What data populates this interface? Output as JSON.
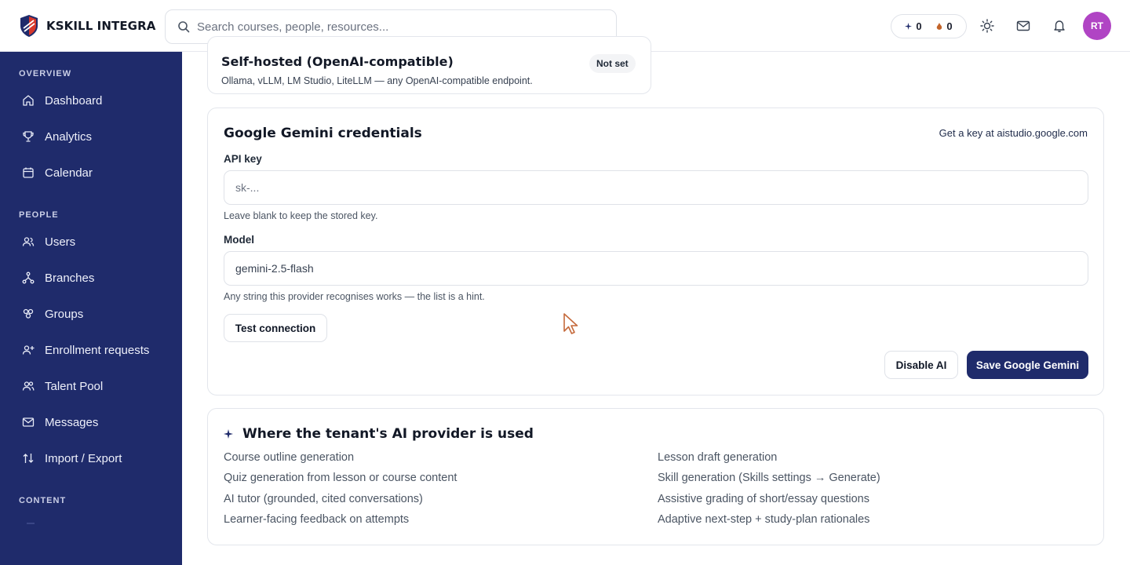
{
  "brand": {
    "name": "KSKILL INTEGRA"
  },
  "search": {
    "placeholder": "Search courses, people, resources..."
  },
  "header": {
    "sparkle_count": "0",
    "flame_count": "0",
    "avatar_initials": "RT",
    "icons": [
      "sun-icon",
      "mail-icon",
      "bell-icon"
    ]
  },
  "sidebar": {
    "sections": [
      {
        "label": "OVERVIEW"
      },
      {
        "label": "PEOPLE"
      },
      {
        "label": "CONTENT"
      }
    ],
    "items": [
      {
        "label": "Dashboard",
        "icon": "home-icon"
      },
      {
        "label": "Analytics",
        "icon": "trophy-icon"
      },
      {
        "label": "Calendar",
        "icon": "calendar-icon"
      },
      {
        "label": "Users",
        "icon": "users-icon"
      },
      {
        "label": "Branches",
        "icon": "branch-icon"
      },
      {
        "label": "Groups",
        "icon": "groups-icon"
      },
      {
        "label": "Enrollment requests",
        "icon": "user-plus-icon"
      },
      {
        "label": "Talent Pool",
        "icon": "talent-icon"
      },
      {
        "label": "Messages",
        "icon": "mail-icon"
      },
      {
        "label": "Import / Export",
        "icon": "import-export-icon"
      }
    ]
  },
  "self_hosted": {
    "title": "Self-hosted (OpenAI-compatible)",
    "description": "Ollama, vLLM, LM Studio, LiteLLM — any OpenAI-compatible endpoint.",
    "status": "Not set"
  },
  "gemini": {
    "title": "Google Gemini credentials",
    "link": "Get a key at aistudio.google.com",
    "api_key_label": "API key",
    "api_key_placeholder": "sk-...",
    "api_key_hint": "Leave blank to keep the stored key.",
    "model_label": "Model",
    "model_value": "gemini-2.5-flash",
    "model_hint": "Any string this provider recognises works — the list is a hint.",
    "test_button": "Test connection",
    "disable_button": "Disable AI",
    "save_button": "Save Google Gemini"
  },
  "usage": {
    "title": "Where the tenant's AI provider is used",
    "items_left": [
      "Course outline generation",
      "Quiz generation from lesson or course content",
      "AI tutor (grounded, cited conversations)",
      "Learner-facing feedback on attempts"
    ],
    "items_right": [
      "Lesson draft generation",
      "Skill generation (Skills settings → Generate)",
      "Assistive grading of short/essay questions",
      "Adaptive next-step + study-plan rationales"
    ]
  },
  "colors": {
    "sidebar_bg": "#1f2b6b",
    "primary": "#1f2b6b",
    "avatar_bg": "#b044c4",
    "logo_red": "#d6372b"
  }
}
